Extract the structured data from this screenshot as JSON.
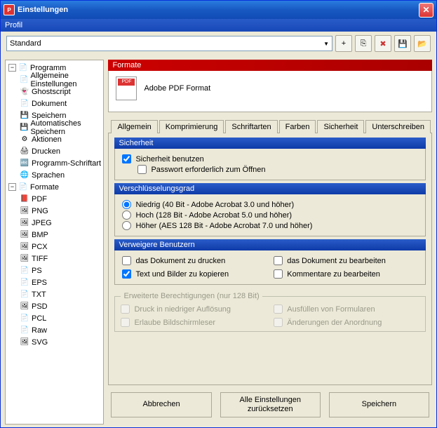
{
  "window": {
    "title": "Einstellungen"
  },
  "profile": {
    "label": "Profil",
    "selected": "Standard"
  },
  "toolbar_icons": {
    "add": "+",
    "copy": "⎘",
    "delete": "✖",
    "save": "💾",
    "open": "📂"
  },
  "sidebar": {
    "programm": {
      "label": "Programm",
      "items": [
        {
          "label": "Allgemeine Einstellungen",
          "icon": "📄"
        },
        {
          "label": "Ghostscript",
          "icon": "👻"
        },
        {
          "label": "Dokument",
          "icon": "📄"
        },
        {
          "label": "Speichern",
          "icon": "💾"
        },
        {
          "label": "Automatisches Speichern",
          "icon": "💾"
        },
        {
          "label": "Aktionen",
          "icon": "⚙"
        },
        {
          "label": "Drucken",
          "icon": "🖨"
        },
        {
          "label": "Programm-Schriftart",
          "icon": "🔤"
        },
        {
          "label": "Sprachen",
          "icon": "🌐"
        }
      ]
    },
    "formate": {
      "label": "Formate",
      "items": [
        {
          "label": "PDF",
          "icon": "📕"
        },
        {
          "label": "PNG",
          "icon": "🖼"
        },
        {
          "label": "JPEG",
          "icon": "🖼"
        },
        {
          "label": "BMP",
          "icon": "🖼"
        },
        {
          "label": "PCX",
          "icon": "🖼"
        },
        {
          "label": "TIFF",
          "icon": "🖼"
        },
        {
          "label": "PS",
          "icon": "📄"
        },
        {
          "label": "EPS",
          "icon": "📄"
        },
        {
          "label": "TXT",
          "icon": "📄"
        },
        {
          "label": "PSD",
          "icon": "🖼"
        },
        {
          "label": "PCL",
          "icon": "📄"
        },
        {
          "label": "Raw",
          "icon": "📄"
        },
        {
          "label": "SVG",
          "icon": "🖼"
        }
      ]
    }
  },
  "format_panel": {
    "header": "Formate",
    "title": "Adobe PDF Format"
  },
  "tabs": [
    "Allgemein",
    "Komprimierung",
    "Schriftarten",
    "Farben",
    "Sicherheit",
    "Unterschreiben"
  ],
  "active_tab": 4,
  "security": {
    "section_title": "Sicherheit",
    "use_security": {
      "label": "Sicherheit benutzen",
      "checked": true
    },
    "pwd_open": {
      "label": "Passwort erforderlich zum Öffnen",
      "checked": false
    }
  },
  "encryption": {
    "title": "Verschlüsselungsgrad",
    "options": [
      {
        "label": "Niedrig (40 Bit - Adobe Acrobat 3.0 und höher)",
        "selected": true
      },
      {
        "label": "Hoch (128 Bit - Adobe Acrobat 5.0 und höher)",
        "selected": false
      },
      {
        "label": "Höher (AES 128 Bit - Adobe Acrobat 7.0 und höher)",
        "selected": false
      }
    ]
  },
  "deny": {
    "title": "Verweigere Benutzern",
    "items": [
      {
        "label": "das Dokument zu drucken",
        "checked": false
      },
      {
        "label": "das Dokument zu bearbeiten",
        "checked": false
      },
      {
        "label": "Text und Bilder zu kopieren",
        "checked": true
      },
      {
        "label": "Kommentare zu bearbeiten",
        "checked": false
      }
    ]
  },
  "extended": {
    "title": "Erweiterte Berechtigungen (nur 128 Bit)",
    "items": [
      {
        "label": "Druck in niedriger Auflösung"
      },
      {
        "label": "Ausfüllen von Formularen"
      },
      {
        "label": "Erlaube Bildschirmleser"
      },
      {
        "label": "Änderungen der Anordnung"
      }
    ]
  },
  "buttons": {
    "cancel": "Abbrechen",
    "reset": "Alle Einstellungen\nzurücksetzen",
    "save": "Speichern"
  }
}
